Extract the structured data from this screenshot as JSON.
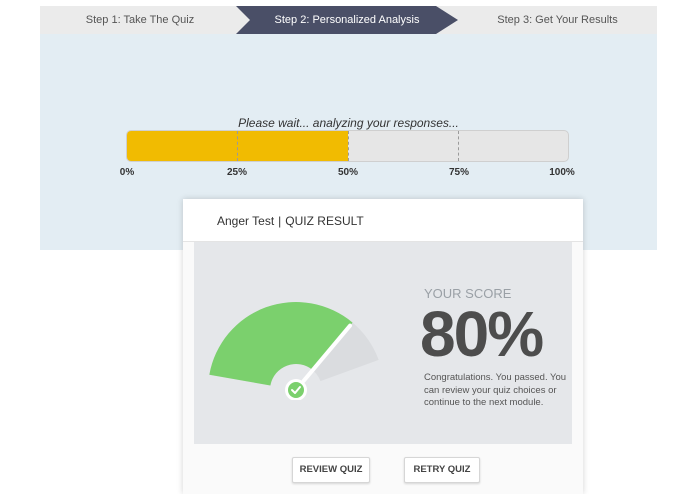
{
  "steps": [
    {
      "label": "Step 1: Take The Quiz"
    },
    {
      "label": "Step 2: Personalized Analysis"
    },
    {
      "label": "Step 3: Get Your Results"
    }
  ],
  "analysis": {
    "message": "Please wait... analyzing your responses...",
    "progress_percent": 50,
    "ticks": [
      "0%",
      "25%",
      "50%",
      "75%",
      "100%"
    ]
  },
  "result": {
    "quiz_name": "Anger Test",
    "separator": "|",
    "header_suffix": "QUIZ RESULT",
    "score_caption": "YOUR SCORE",
    "score_value": "80%",
    "score_percent": 80,
    "message": "Congratulations. You passed. You can review your quiz choices or continue to the next module.",
    "review_label": "REVIEW QUIZ",
    "retry_label": "RETRY QUIZ"
  },
  "colors": {
    "active_step": "#4a4f67",
    "progress_fill": "#f1bb01",
    "gauge_pass": "#7bd06d",
    "gauge_rest": "#dadcdf"
  }
}
